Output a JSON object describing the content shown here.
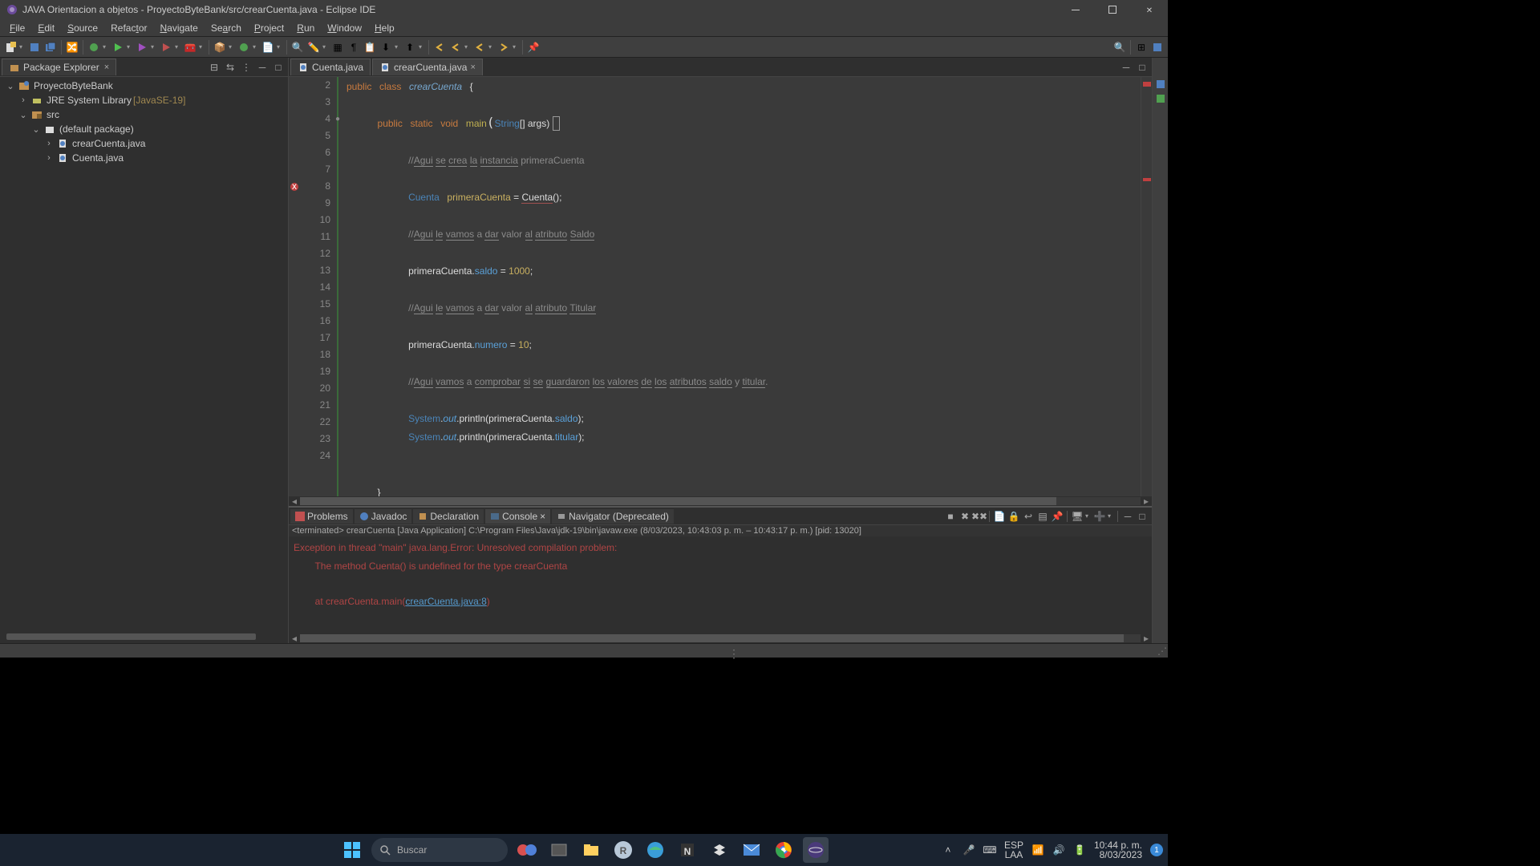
{
  "titlebar": {
    "text": "JAVA Orientacion a objetos - ProyectoByteBank/src/crearCuenta.java - Eclipse IDE"
  },
  "menu": {
    "file": "File",
    "edit": "Edit",
    "source": "Source",
    "refactor": "Refactor",
    "navigate": "Navigate",
    "search": "Search",
    "project": "Project",
    "run": "Run",
    "window": "Window",
    "help": "Help"
  },
  "package_explorer": {
    "title": "Package Explorer",
    "project": "ProyectoByteBank",
    "jre": "JRE System Library",
    "jre_suffix": "[JavaSE-19]",
    "src": "src",
    "pkg": "(default package)",
    "file1": "crearCuenta.java",
    "file2": "Cuenta.java"
  },
  "editor_tabs": {
    "t1": "Cuenta.java",
    "t2": "crearCuenta.java"
  },
  "code": {
    "l2_kw1": "public",
    "l2_kw2": "class",
    "l2_name": "crearCuenta",
    "l2_brace": "{",
    "l4_kw1": "public",
    "l4_kw2": "static",
    "l4_kw3": "void",
    "l4_main": "main",
    "l4_str": "String",
    "l4_rest": "[] args) ",
    "l6_pre": "//",
    "l6_u1": "Agui",
    "l6_u2": "se",
    "l6_u3": "crea",
    "l6_u4": "la",
    "l6_u5": "instancia",
    "l6_tail": " primeraCuenta",
    "l8_type": "Cuenta",
    "l8_var": "primeraCuenta",
    "l8_eq": " = ",
    "l8_call": "Cuenta",
    "l8_end": "();",
    "l10_pre": "//",
    "l10_u1": "Agui",
    "l10_u2": "le",
    "l10_u3": "vamos",
    "l10_a": " a ",
    "l10_u4": "dar",
    "l10_valor": " valor ",
    "l10_u5": "al",
    "l10_sp": " ",
    "l10_u6": "atributo",
    "l10_sp2": " ",
    "l10_u7": "Saldo",
    "l12_pc": "primeraCuenta.",
    "l12_f": "saldo",
    "l12_eq": " = ",
    "l12_n": "1000",
    "l12_end": ";",
    "l14_pre": "//",
    "l14_u1": "Agui",
    "l14_u2": "le",
    "l14_u3": "vamos",
    "l14_a": " a ",
    "l14_u4": "dar",
    "l14_valor": " valor ",
    "l14_u5": "al",
    "l14_sp": " ",
    "l14_u6": "atributo",
    "l14_sp2": " ",
    "l14_u7": "Titular",
    "l16_pc": "primeraCuenta.",
    "l16_f": "numero",
    "l16_eq": " = ",
    "l16_n": "10",
    "l16_end": ";",
    "l18_pre": "//",
    "l18_u1": "Agui",
    "l18_sp": " ",
    "l18_u2": "vamos",
    "l18_a": " a ",
    "l18_u3": "comprobar",
    "l18_sp2": " ",
    "l18_u4": "si",
    "l18_sp3": " ",
    "l18_u5": "se",
    "l18_sp4": " ",
    "l18_u6": "guardaron",
    "l18_sp5": " ",
    "l18_u7": "los",
    "l18_sp6": " ",
    "l18_u8": "valores",
    "l18_sp7": " ",
    "l18_u9": "de",
    "l18_sp8": " ",
    "l18_u10": "los",
    "l18_sp9": " ",
    "l18_u11": "atributos",
    "l18_sp10": " ",
    "l18_u12": "saldo",
    "l18_y": " y ",
    "l18_u13": "titular",
    "l18_dot": ".",
    "l20_sys": "System",
    "l20_dot": ".",
    "l20_out": "out",
    "l20_pr": ".println",
    "l20_arg": "(primeraCuenta.",
    "l20_f": "saldo",
    "l20_end": ");",
    "l21_sys": "System",
    "l21_dot": ".",
    "l21_out": "out",
    "l21_pr": ".println",
    "l21_arg": "(primeraCuenta.",
    "l21_f": "titular",
    "l21_end": ");",
    "l24_brace": "}"
  },
  "line_numbers": {
    "n2": "2",
    "n3": "3",
    "n4": "4",
    "n5": "5",
    "n6": "6",
    "n7": "7",
    "n8": "8",
    "n9": "9",
    "n10": "10",
    "n11": "11",
    "n12": "12",
    "n13": "13",
    "n14": "14",
    "n15": "15",
    "n16": "16",
    "n17": "17",
    "n18": "18",
    "n19": "19",
    "n20": "20",
    "n21": "21",
    "n22": "22",
    "n23": "23",
    "n24": "24"
  },
  "bottom_tabs": {
    "problems": "Problems",
    "javadoc": "Javadoc",
    "declaration": "Declaration",
    "console": "Console",
    "navigator": "Navigator (Deprecated)"
  },
  "terminated": "<terminated> crearCuenta [Java Application] C:\\Program Files\\Java\\jdk-19\\bin\\javaw.exe  (8/03/2023, 10:43:03 p. m. – 10:43:17 p. m.) [pid: 13020]",
  "console": {
    "l1": "Exception in thread \"main\" java.lang.Error: Unresolved compilation problem: ",
    "l2": "        The method Cuenta() is undefined for the type crearCuenta",
    "l3_pre": "        at crearCuenta.main(",
    "l3_link": "crearCuenta.java:8",
    "l3_post": ")"
  },
  "taskbar": {
    "search": "Buscar",
    "lang1": "ESP",
    "lang2": "LAA",
    "time": "10:44 p. m.",
    "date": "8/03/2023",
    "notif": "1"
  }
}
